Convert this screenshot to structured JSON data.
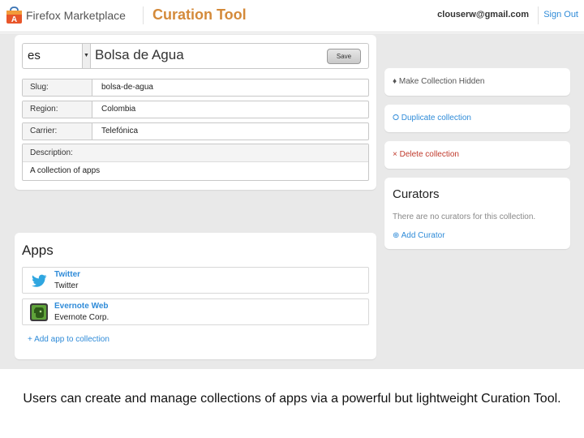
{
  "header": {
    "brand": "Firefox Marketplace",
    "tool_title": "Curation Tool",
    "user_email": "clouserw@gmail.com",
    "signout_label": "Sign Out"
  },
  "collection": {
    "language": "es",
    "name": "Bolsa de Agua",
    "save_label": "Save",
    "fields": [
      {
        "label": "Slug:",
        "value": "bolsa-de-agua"
      },
      {
        "label": "Region:",
        "value": "Colombia"
      },
      {
        "label": "Carrier:",
        "value": "Telefónica"
      }
    ],
    "description_label": "Description:",
    "description_value": "A collection of apps"
  },
  "apps": {
    "title": "Apps",
    "items": [
      {
        "name": "Twitter",
        "developer": "Twitter",
        "icon": "twitter-bird-icon"
      },
      {
        "name": "Evernote Web",
        "developer": "Evernote Corp.",
        "icon": "evernote-elephant-icon"
      }
    ],
    "add_label": "+ Add app to collection"
  },
  "actions": {
    "hide_label": "♦ Make Collection Hidden",
    "duplicate_label": "⭘ Duplicate collection",
    "delete_label": "× Delete collection"
  },
  "curators": {
    "title": "Curators",
    "empty_text": "There are no curators for this collection.",
    "add_label": "⊕ Add Curator"
  },
  "caption": "Users can create and manage collections of apps via a powerful but lightweight Curation Tool.",
  "colors": {
    "accent_orange": "#d48a3a",
    "link_blue": "#2f8bd8",
    "delete_red": "#c0392b",
    "page_gray": "#e9e9e9"
  }
}
